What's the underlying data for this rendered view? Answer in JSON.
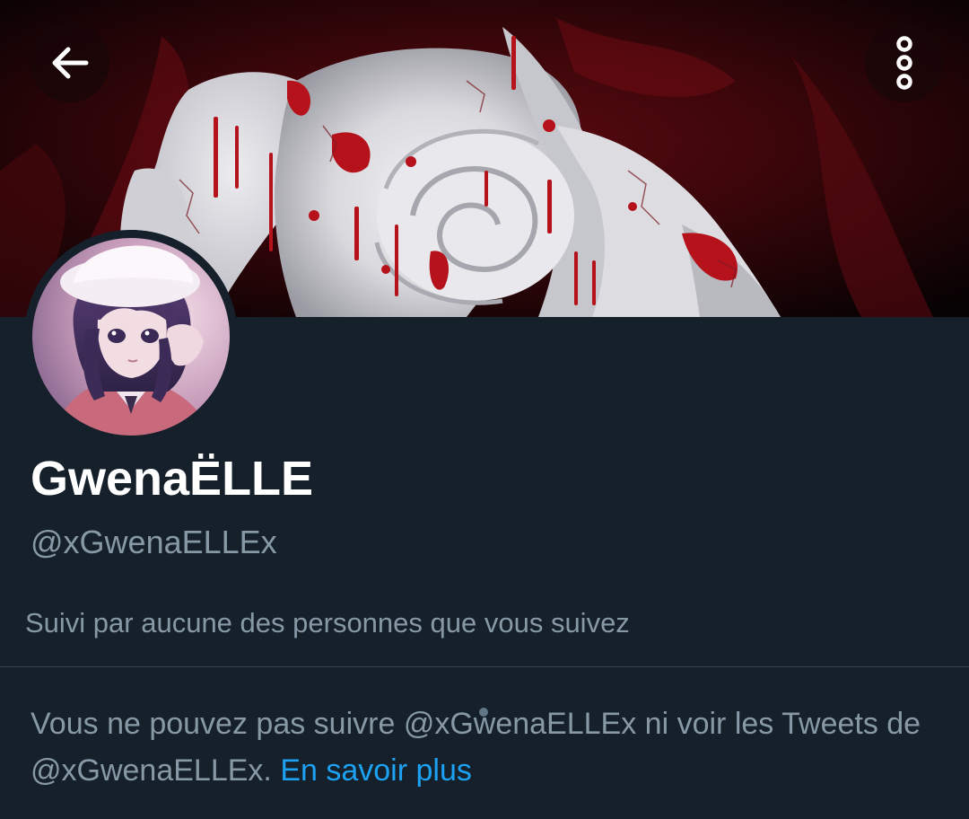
{
  "profile": {
    "display_name": "GwenaËLLE",
    "handle": "@xGwenaELLEx",
    "followed_by": "Suivi par aucune des personnes que vous suivez"
  },
  "blocked_notice": {
    "text": "Vous ne pouvez pas suivre @xGwenaELLEx ni voir les Tweets de @xGwenaELLEx.",
    "link_label": "En savoir plus"
  },
  "icons": {
    "back": "arrow-left-icon",
    "more": "more-vertical-icon"
  },
  "colors": {
    "background": "#15202b",
    "primary_text": "#ffffff",
    "secondary_text": "#8899a6",
    "link": "#1da1f2",
    "divider": "#38444d"
  }
}
